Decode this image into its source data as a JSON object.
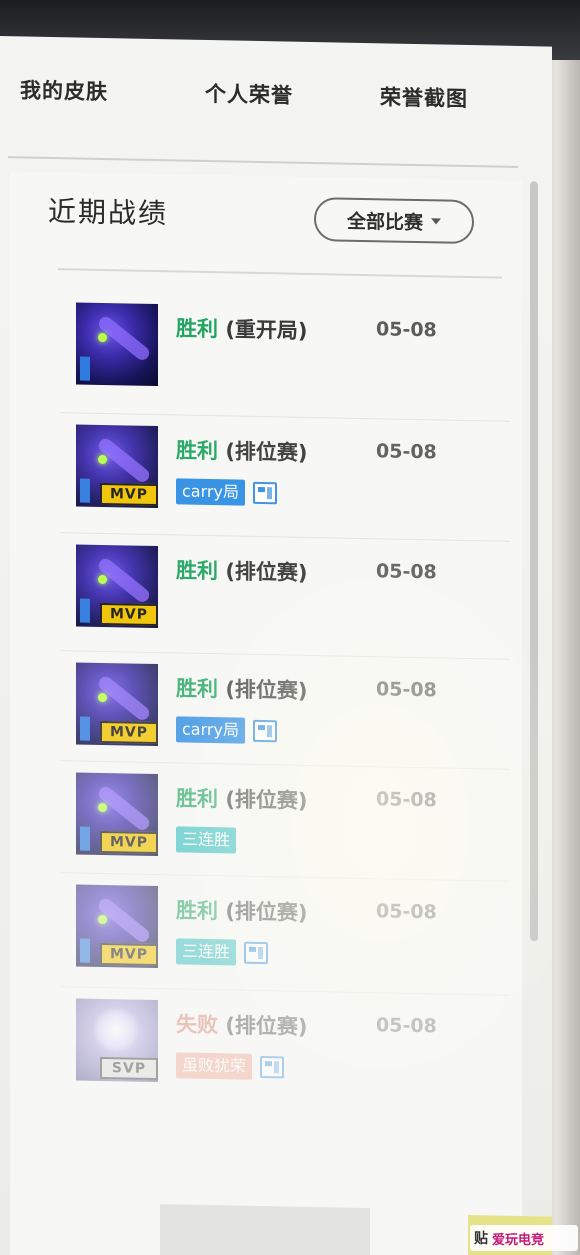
{
  "tabs": [
    "我的皮肤",
    "个人荣誉",
    "荣誉截图"
  ],
  "panel": {
    "title": "近期战绩",
    "filter_label": "全部比赛"
  },
  "matches": [
    {
      "result_word": "胜利",
      "mode": "(重开局)",
      "date": "05-08",
      "badge": "",
      "tags": [],
      "has_share": false
    },
    {
      "result_word": "胜利",
      "mode": "(排位赛)",
      "date": "05-08",
      "badge": "MVP",
      "tags": [
        "carry局"
      ],
      "has_share": true
    },
    {
      "result_word": "胜利",
      "mode": "(排位赛)",
      "date": "05-08",
      "badge": "MVP",
      "tags": [],
      "has_share": false
    },
    {
      "result_word": "胜利",
      "mode": "(排位赛)",
      "date": "05-08",
      "badge": "MVP",
      "tags": [
        "carry局"
      ],
      "has_share": true
    },
    {
      "result_word": "胜利",
      "mode": "(排位赛)",
      "date": "05-08",
      "badge": "MVP",
      "tags": [
        "三连胜"
      ],
      "has_share": false
    },
    {
      "result_word": "胜利",
      "mode": "(排位赛)",
      "date": "05-08",
      "badge": "MVP",
      "tags": [
        "三连胜"
      ],
      "has_share": true
    },
    {
      "result_word": "失败",
      "mode": "(排位赛)",
      "date": "05-08",
      "badge": "SVP",
      "tags": [
        "虽败犹荣"
      ],
      "has_share": true
    }
  ],
  "watermark": {
    "prefix": "贴",
    "brand": "爱玩电竞"
  },
  "colors": {
    "win": "#21a561",
    "loss": "#d9745a",
    "mvp": "#f2c400",
    "carry": "#2f8fe6"
  }
}
